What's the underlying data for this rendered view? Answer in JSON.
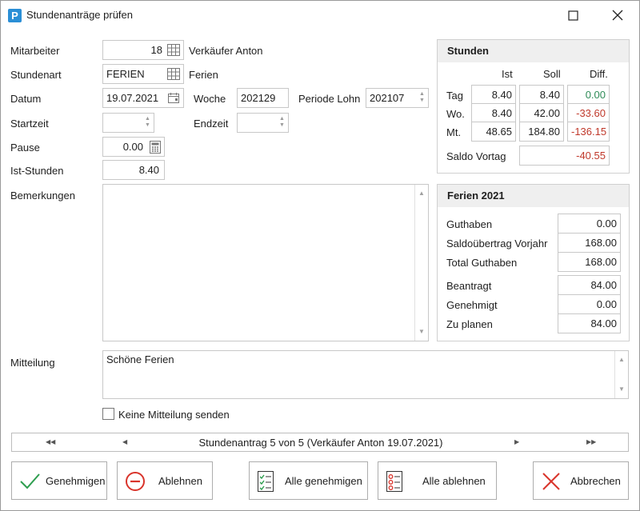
{
  "window": {
    "title": "Stundenanträge prüfen",
    "app_icon_letter": "P"
  },
  "form": {
    "mitarbeiter": {
      "label": "Mitarbeiter",
      "value": "18",
      "name": "Verkäufer Anton"
    },
    "stundenart": {
      "label": "Stundenart",
      "value": "FERIEN",
      "name": "Ferien"
    },
    "datum": {
      "label": "Datum",
      "value": "19.07.2021"
    },
    "woche": {
      "label": "Woche",
      "value": "202129"
    },
    "periode": {
      "label": "Periode Lohn",
      "value": "202107"
    },
    "startzeit": {
      "label": "Startzeit",
      "value": ""
    },
    "endzeit": {
      "label": "Endzeit",
      "value": ""
    },
    "pause": {
      "label": "Pause",
      "value": "0.00"
    },
    "ist_stunden": {
      "label": "Ist-Stunden",
      "value": "8.40"
    },
    "bemerkungen": {
      "label": "Bemerkungen",
      "value": ""
    },
    "mitteilung": {
      "label": "Mitteilung",
      "value": "Schöne Ferien"
    },
    "keine_mitteilung": {
      "label": "Keine Mitteilung senden",
      "checked": false
    }
  },
  "stunden": {
    "title": "Stunden",
    "headers": [
      "Ist",
      "Soll",
      "Diff."
    ],
    "rows": [
      {
        "label": "Tag",
        "ist": "8.40",
        "soll": "8.40",
        "diff": "0.00"
      },
      {
        "label": "Wo.",
        "ist": "8.40",
        "soll": "42.00",
        "diff": "-33.60"
      },
      {
        "label": "Mt.",
        "ist": "48.65",
        "soll": "184.80",
        "diff": "-136.15"
      }
    ],
    "saldo": {
      "label": "Saldo Vortag",
      "value": "-40.55"
    },
    "colors": {
      "positive": "#2e8b57",
      "negative": "#c0392b"
    }
  },
  "ferien": {
    "title": "Ferien 2021",
    "rows": [
      {
        "label": "Guthaben",
        "value": "0.00"
      },
      {
        "label": "Saldoübertrag Vorjahr",
        "value": "168.00"
      },
      {
        "label": "Total Guthaben",
        "value": "168.00"
      },
      {
        "label": "Beantragt",
        "value": "84.00"
      },
      {
        "label": "Genehmigt",
        "value": "0.00"
      },
      {
        "label": "Zu planen",
        "value": "84.00"
      }
    ]
  },
  "navigator": {
    "text": "Stundenantrag 5 von 5 (Verkäufer Anton 19.07.2021)"
  },
  "buttons": {
    "genehmigen": "Genehmigen",
    "ablehnen": "Ablehnen",
    "alle_genehmigen": "Alle genehmigen",
    "alle_ablehnen": "Alle ablehnen",
    "abbrechen": "Abbrechen"
  }
}
